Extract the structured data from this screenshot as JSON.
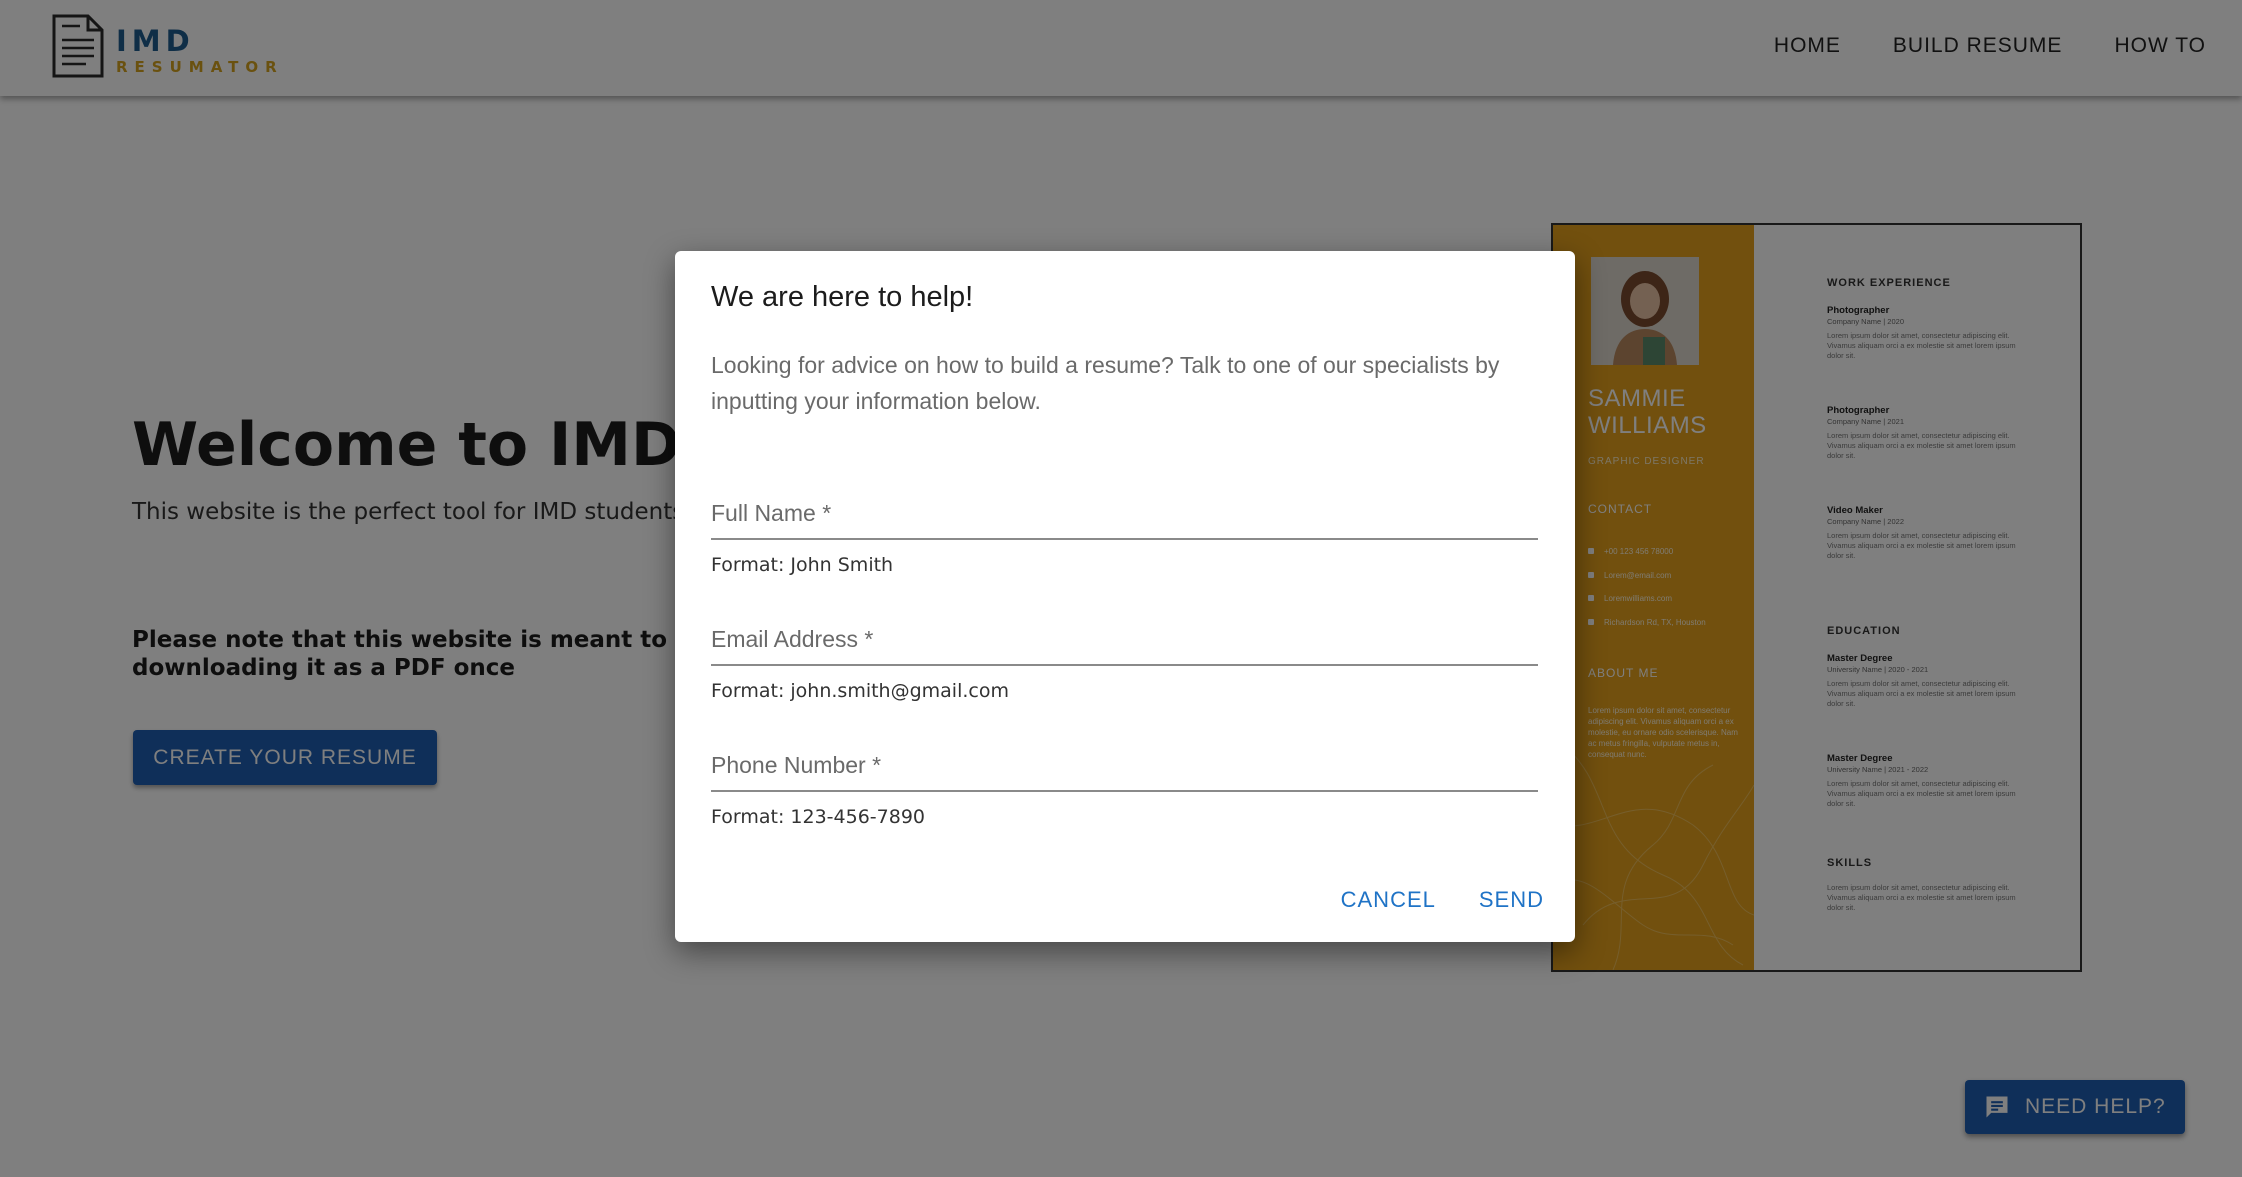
{
  "header": {
    "logo": {
      "name": "IMD",
      "tagline": "RESUMATOR"
    },
    "nav": [
      {
        "label": "HOME"
      },
      {
        "label": "BUILD RESUME"
      },
      {
        "label": "HOW TO"
      }
    ]
  },
  "hero": {
    "title": "Welcome to IMD Re",
    "description": "This website is the perfect tool for IMD students to when they apply to any jobs in tech!",
    "note": "Please note that this website is meant to be used t save your resume by downloading it as a PDF once",
    "cta_label": "CREATE YOUR RESUME"
  },
  "resume_preview": {
    "name_line1": "SAMMIE",
    "name_line2": "WILLIAMS",
    "role": "GRAPHIC DESIGNER",
    "contact_heading": "CONTACT",
    "contact_items": [
      "+00 123 456 78000",
      "Lorem@email.com",
      "Loremwilliams.com",
      "Richardson Rd, TX, Houston"
    ],
    "about_heading": "ABOUT ME",
    "about_text": "Lorem ipsum dolor sit amet, consectetur adipiscing elit. Vivamus aliquam orci a ex molestie, eu ornare odio scelerisque. Nam ac metus fringilla, vulputate metus in, consequat nunc.",
    "work_heading": "WORK EXPERIENCE",
    "work": [
      {
        "title": "Photographer",
        "sub": "Company Name | 2020",
        "desc": "Lorem ipsum dolor sit amet, consectetur adipiscing elit. Vivamus aliquam orci a ex molestie sit amet lorem ipsum dolor sit."
      },
      {
        "title": "Photographer",
        "sub": "Company Name | 2021",
        "desc": "Lorem ipsum dolor sit amet, consectetur adipiscing elit. Vivamus aliquam orci a ex molestie sit amet lorem ipsum dolor sit."
      },
      {
        "title": "Video Maker",
        "sub": "Company Name | 2022",
        "desc": "Lorem ipsum dolor sit amet, consectetur adipiscing elit. Vivamus aliquam orci a ex molestie sit amet lorem ipsum dolor sit."
      }
    ],
    "education_heading": "EDUCATION",
    "education": [
      {
        "title": "Master Degree",
        "sub": "University Name | 2020 - 2021",
        "desc": "Lorem ipsum dolor sit amet, consectetur adipiscing elit. Vivamus aliquam orci a ex molestie sit amet lorem ipsum dolor sit."
      },
      {
        "title": "Master Degree",
        "sub": "University Name | 2021 - 2022",
        "desc": "Lorem ipsum dolor sit amet, consectetur adipiscing elit. Vivamus aliquam orci a ex molestie sit amet lorem ipsum dolor sit."
      }
    ],
    "skills_heading": "SKILLS",
    "skills_text": "Lorem ipsum dolor sit amet, consectetur adipiscing elit. Vivamus aliquam orci a ex molestie sit amet lorem ipsum dolor sit."
  },
  "dialog": {
    "title": "We are here to help!",
    "text": "Looking for advice on how to build a resume? Talk to one of our specialists by inputting your information below.",
    "fields": [
      {
        "placeholder": "Full Name *",
        "value": "",
        "hint": "Format: John Smith"
      },
      {
        "placeholder": "Email Address *",
        "value": "",
        "hint": "Format: john.smith@gmail.com"
      },
      {
        "placeholder": "Phone Number *",
        "value": "",
        "hint": "Format: 123-456-7890"
      }
    ],
    "cancel_label": "CANCEL",
    "send_label": "SEND"
  },
  "help_button": {
    "label": "NEED HELP?",
    "icon": "chat-icon"
  },
  "colors": {
    "brand_blue": "#1f5fb3",
    "logo_blue": "#1f5d8e",
    "logo_gold": "#d4a21e",
    "resume_gold": "#e4a01c",
    "link_blue": "#1f73c6",
    "overlay": "rgba(0,0,0,0.5)"
  }
}
